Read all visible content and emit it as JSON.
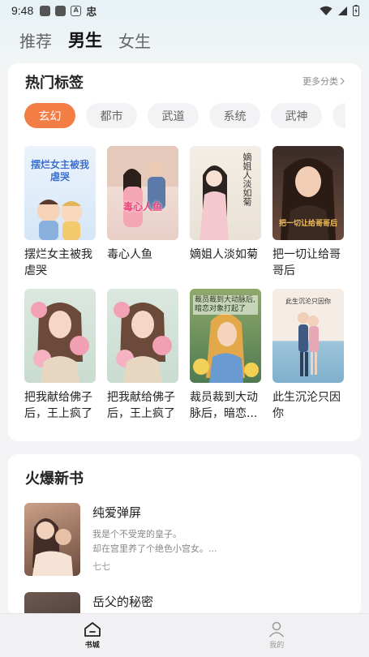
{
  "status_bar": {
    "time": "9:48",
    "icon_char": "忠"
  },
  "top_tabs": [
    {
      "label": "推荐",
      "active": false
    },
    {
      "label": "男生",
      "active": true
    },
    {
      "label": "女生",
      "active": false
    }
  ],
  "hot_tags": {
    "title": "热门标签",
    "more": "更多分类",
    "tags": [
      "玄幻",
      "都市",
      "武道",
      "系统",
      "武神",
      "护"
    ],
    "books": [
      {
        "title": "摆烂女主被我虐哭",
        "cover_text": "摆烂女主被我虐哭"
      },
      {
        "title": "毒心人鱼",
        "cover_text": "毒心人鱼"
      },
      {
        "title": "嫡姐人淡如菊",
        "cover_text": "嫡姐人淡如菊"
      },
      {
        "title": "把一切让给哥哥后",
        "cover_text": "把一切让给哥哥后"
      },
      {
        "title": "把我献给佛子后，王上疯了",
        "cover_text": ""
      },
      {
        "title": "把我献给佛子后，王上疯了",
        "cover_text": ""
      },
      {
        "title": "裁员裁到大动脉后，暗恋...",
        "cover_text": "裁员裁到大动脉后,暗恋对象打起了"
      },
      {
        "title": "此生沉沦只因你",
        "cover_text": "此生沉沦只因你"
      }
    ]
  },
  "new_books": {
    "title": "火爆新书",
    "items": [
      {
        "title": "纯爱弹屏",
        "desc_line1": "我是个不受宠的皇子。",
        "desc_line2": "却在宫里养了个绝色小宫女。...",
        "author": "七七"
      },
      {
        "title": "岳父的秘密",
        "desc_line1": "",
        "desc_line2": "",
        "author": ""
      }
    ]
  },
  "bottom_nav": [
    {
      "label": "书城",
      "icon": "home-icon",
      "active": true
    },
    {
      "label": "我的",
      "icon": "user-icon",
      "active": false
    }
  ],
  "colors": {
    "accent": "#f27d45",
    "background": "#f4f4f6"
  }
}
